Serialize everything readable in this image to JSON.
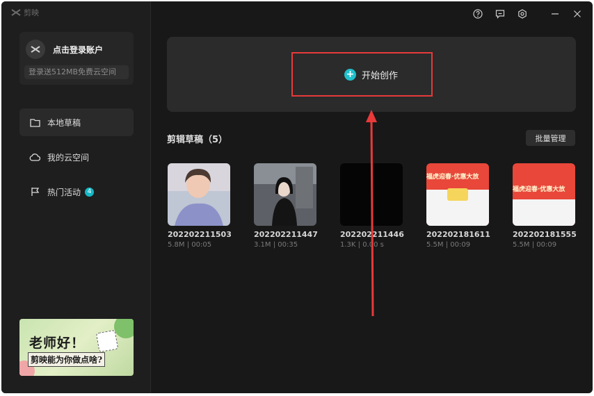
{
  "app": {
    "name": "剪映"
  },
  "account": {
    "login_label": "点击登录账户",
    "promo": "登录送512MB免费云空间"
  },
  "sidebar": {
    "items": [
      {
        "label": "本地草稿",
        "icon": "folder-icon"
      },
      {
        "label": "我的云空间",
        "icon": "cloud-icon"
      },
      {
        "label": "热门活动",
        "icon": "flag-icon",
        "badge": "4"
      }
    ]
  },
  "banner": {
    "line1": "老师好！",
    "line2": "剪映能为你做点啥?"
  },
  "topbar": {
    "icons": [
      "help-icon",
      "feedback-icon",
      "settings-icon"
    ]
  },
  "create": {
    "label": "开始创作"
  },
  "drafts": {
    "title": "剪辑草稿（5）",
    "batch_label": "批量管理",
    "items": [
      {
        "name": "202202211503",
        "meta": "5.8M | 00:05"
      },
      {
        "name": "202202211447",
        "meta": "3.1M | 00:35"
      },
      {
        "name": "202202211446",
        "meta": "1.3K | 0.00 s"
      },
      {
        "name": "202202181611",
        "meta": "5.5M | 00:09"
      },
      {
        "name": "202202181555",
        "meta": "5.5M | 00:09"
      }
    ],
    "thumb_text": "福虎迎春·优惠大放"
  },
  "colors": {
    "accent": "#16b8c7",
    "highlight": "#e83a3a"
  }
}
